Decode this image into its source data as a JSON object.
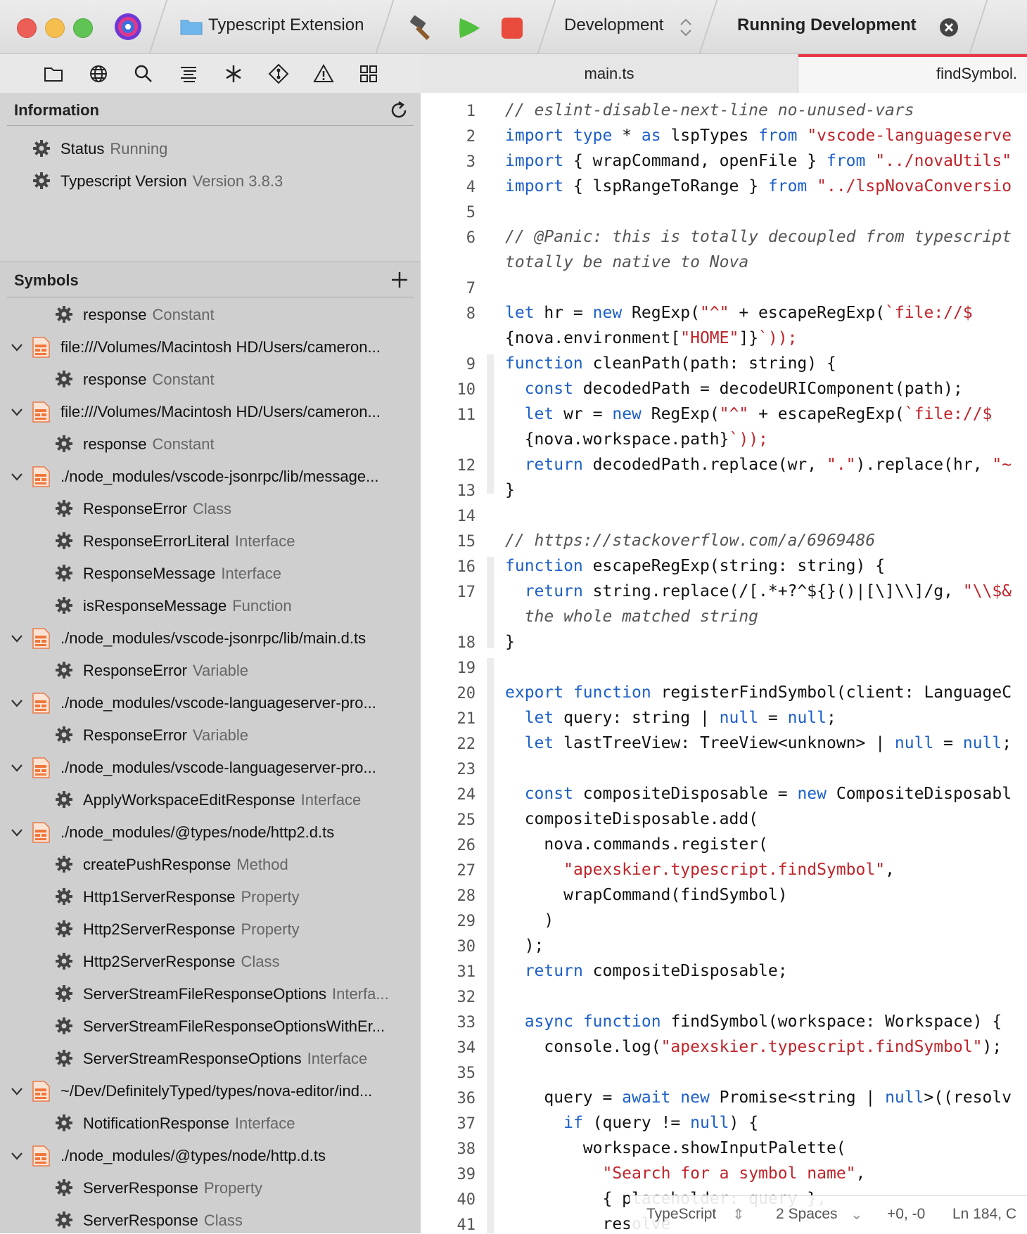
{
  "titlebar": {
    "project": "Typescript Extension",
    "scheme": "Development",
    "task": "Running Development"
  },
  "editor_tabs": [
    {
      "label": "main.ts"
    },
    {
      "label": "findSymbol."
    }
  ],
  "information": {
    "title": "Information",
    "rows": [
      {
        "label": "Status",
        "value": "Running"
      },
      {
        "label": "Typescript Version",
        "value": "Version 3.8.3"
      }
    ]
  },
  "symbols": {
    "title": "Symbols",
    "items": [
      {
        "type": "symbol",
        "name": "response",
        "kind": "Constant"
      },
      {
        "type": "file",
        "name": "file:///Volumes/Macintosh HD/Users/cameron..."
      },
      {
        "type": "symbol",
        "name": "response",
        "kind": "Constant"
      },
      {
        "type": "file",
        "name": "file:///Volumes/Macintosh HD/Users/cameron..."
      },
      {
        "type": "symbol",
        "name": "response",
        "kind": "Constant"
      },
      {
        "type": "file",
        "name": "./node_modules/vscode-jsonrpc/lib/message..."
      },
      {
        "type": "symbol",
        "name": "ResponseError",
        "kind": "Class"
      },
      {
        "type": "symbol",
        "name": "ResponseErrorLiteral",
        "kind": "Interface"
      },
      {
        "type": "symbol",
        "name": "ResponseMessage",
        "kind": "Interface"
      },
      {
        "type": "symbol",
        "name": "isResponseMessage",
        "kind": "Function"
      },
      {
        "type": "file",
        "name": "./node_modules/vscode-jsonrpc/lib/main.d.ts"
      },
      {
        "type": "symbol",
        "name": "ResponseError",
        "kind": "Variable"
      },
      {
        "type": "file",
        "name": "./node_modules/vscode-languageserver-pro..."
      },
      {
        "type": "symbol",
        "name": "ResponseError",
        "kind": "Variable"
      },
      {
        "type": "file",
        "name": "./node_modules/vscode-languageserver-pro..."
      },
      {
        "type": "symbol",
        "name": "ApplyWorkspaceEditResponse",
        "kind": "Interface"
      },
      {
        "type": "file",
        "name": "./node_modules/@types/node/http2.d.ts"
      },
      {
        "type": "symbol",
        "name": "createPushResponse",
        "kind": "Method"
      },
      {
        "type": "symbol",
        "name": "Http1ServerResponse",
        "kind": "Property"
      },
      {
        "type": "symbol",
        "name": "Http2ServerResponse",
        "kind": "Property"
      },
      {
        "type": "symbol",
        "name": "Http2ServerResponse",
        "kind": "Class"
      },
      {
        "type": "symbol",
        "name": "ServerStreamFileResponseOptions",
        "kind": "Interfa..."
      },
      {
        "type": "symbol",
        "name": "ServerStreamFileResponseOptionsWithEr...",
        "kind": ""
      },
      {
        "type": "symbol",
        "name": "ServerStreamResponseOptions",
        "kind": "Interface"
      },
      {
        "type": "file",
        "name": "~/Dev/DefinitelyTyped/types/nova-editor/ind..."
      },
      {
        "type": "symbol",
        "name": "NotificationResponse",
        "kind": "Interface"
      },
      {
        "type": "file",
        "name": "./node_modules/@types/node/http.d.ts"
      },
      {
        "type": "symbol",
        "name": "ServerResponse",
        "kind": "Property"
      },
      {
        "type": "symbol",
        "name": "ServerResponse",
        "kind": "Class"
      }
    ]
  },
  "code_lines": [
    {
      "n": "1",
      "t": "// eslint-disable-next-line no-unused-vars",
      "c": "cm"
    },
    {
      "n": "2",
      "t": "import type * as lspTypes from \"vscode-languageserve",
      "c": ""
    },
    {
      "n": "3",
      "t": "import { wrapCommand, openFile } from \"../novaUtils\"",
      "c": ""
    },
    {
      "n": "4",
      "t": "import { lspRangeToRange } from \"../lspNovaConversio",
      "c": ""
    },
    {
      "n": "5",
      "t": "",
      "c": ""
    },
    {
      "n": "6",
      "t": "// @Panic: this is totally decoupled from typescript",
      "c": "cm"
    },
    {
      "n": "",
      "t": "totally be native to Nova",
      "c": "cm"
    },
    {
      "n": "7",
      "t": "",
      "c": ""
    },
    {
      "n": "8",
      "t": "let hr = new RegExp(\"^\" + escapeRegExp(`file://$",
      "c": ""
    },
    {
      "n": "",
      "t": "{nova.environment[\"HOME\"]}`));",
      "c": ""
    },
    {
      "n": "9",
      "t": "function cleanPath(path: string) {",
      "c": ""
    },
    {
      "n": "10",
      "t": "  const decodedPath = decodeURIComponent(path);",
      "c": ""
    },
    {
      "n": "11",
      "t": "  let wr = new RegExp(\"^\" + escapeRegExp(`file://$",
      "c": ""
    },
    {
      "n": "",
      "t": "  {nova.workspace.path}`));",
      "c": ""
    },
    {
      "n": "12",
      "t": "  return decodedPath.replace(wr, \".\").replace(hr, \"~",
      "c": ""
    },
    {
      "n": "13",
      "t": "}",
      "c": ""
    },
    {
      "n": "14",
      "t": "",
      "c": ""
    },
    {
      "n": "15",
      "t": "// https://stackoverflow.com/a/6969486",
      "c": "cm"
    },
    {
      "n": "16",
      "t": "function escapeRegExp(string: string) {",
      "c": ""
    },
    {
      "n": "17",
      "t": "  return string.replace(/[.*+?^${}()|[\\]\\\\]/g, \"\\\\$&",
      "c": ""
    },
    {
      "n": "",
      "t": "  the whole matched string",
      "c": "cm"
    },
    {
      "n": "18",
      "t": "}",
      "c": ""
    },
    {
      "n": "19",
      "t": "",
      "c": ""
    },
    {
      "n": "20",
      "t": "export function registerFindSymbol(client: LanguageC",
      "c": ""
    },
    {
      "n": "21",
      "t": "  let query: string | null = null;",
      "c": ""
    },
    {
      "n": "22",
      "t": "  let lastTreeView: TreeView<unknown> | null = null;",
      "c": ""
    },
    {
      "n": "23",
      "t": "",
      "c": ""
    },
    {
      "n": "24",
      "t": "  const compositeDisposable = new CompositeDisposabl",
      "c": ""
    },
    {
      "n": "25",
      "t": "  compositeDisposable.add(",
      "c": ""
    },
    {
      "n": "26",
      "t": "    nova.commands.register(",
      "c": ""
    },
    {
      "n": "27",
      "t": "      \"apexskier.typescript.findSymbol\",",
      "c": ""
    },
    {
      "n": "28",
      "t": "      wrapCommand(findSymbol)",
      "c": ""
    },
    {
      "n": "29",
      "t": "    )",
      "c": ""
    },
    {
      "n": "30",
      "t": "  );",
      "c": ""
    },
    {
      "n": "31",
      "t": "  return compositeDisposable;",
      "c": ""
    },
    {
      "n": "32",
      "t": "",
      "c": ""
    },
    {
      "n": "33",
      "t": "  async function findSymbol(workspace: Workspace) {",
      "c": ""
    },
    {
      "n": "34",
      "t": "    console.log(\"apexskier.typescript.findSymbol\");",
      "c": ""
    },
    {
      "n": "35",
      "t": "",
      "c": ""
    },
    {
      "n": "36",
      "t": "    query = await new Promise<string | null>((resolv",
      "c": ""
    },
    {
      "n": "37",
      "t": "      if (query != null) {",
      "c": ""
    },
    {
      "n": "38",
      "t": "        workspace.showInputPalette(",
      "c": ""
    },
    {
      "n": "39",
      "t": "          \"Search for a symbol name\",",
      "c": ""
    },
    {
      "n": "40",
      "t": "          { placeholder: query },",
      "c": ""
    },
    {
      "n": "41",
      "t": "          resolve",
      "c": ""
    }
  ],
  "statusbar": {
    "language": "TypeScript",
    "indent": "2 Spaces",
    "changes": "+0, -0",
    "position": "Ln 184, C"
  },
  "colors": {
    "close": "#ed5e57",
    "minimize": "#f5be4f",
    "zoom": "#5fc454",
    "accent": "#e8394b"
  }
}
